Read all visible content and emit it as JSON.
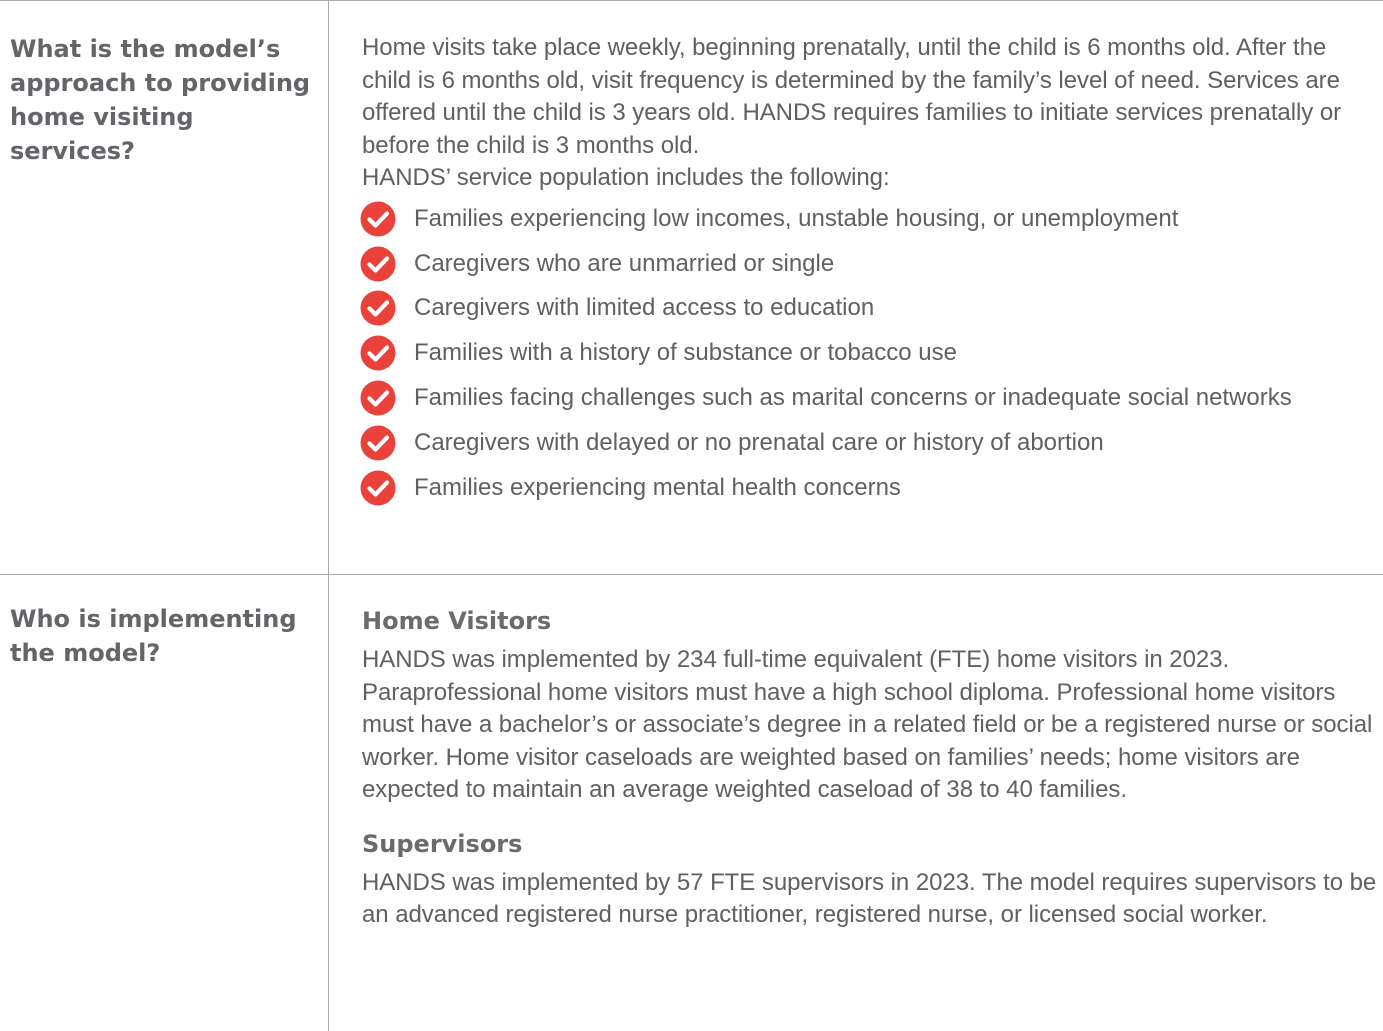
{
  "rows": [
    {
      "question": "What is the model’s approach to providing home visiting services?",
      "paragraph": "Home visits take place weekly, beginning prenatally, until the child is 6 months old. After the child is 6 months old, visit frequency is determined by the family’s level of need. Services are offered until the child is 3 years old. HANDS requires families to initiate services prenatally or before the child is 3 months old.",
      "list_intro": "HANDS’ service population includes the following:",
      "list": [
        "Families experiencing low incomes, unstable housing, or unemployment",
        "Caregivers who are unmarried or single",
        "Caregivers with limited access to education",
        "Families with a history of substance or tobacco use",
        "Families facing challenges such as marital concerns or inadequate social networks",
        "Caregivers with delayed or no prenatal care or history of abortion",
        "Families experiencing mental health concerns"
      ],
      "check_icon": "check-circle-icon",
      "check_color": "#e8423b"
    },
    {
      "question": "Who is implementing the model?",
      "sections": [
        {
          "heading": "Home Visitors",
          "body": "HANDS was implemented by 234 full-time equivalent (FTE) home visitors in 2023. Paraprofessional home visitors must have a high school diploma. Professional home visitors must have a bachelor’s or associate’s degree in a related field or be a registered nurse or social worker. Home visitor caseloads are weighted based on families’ needs; home visitors are expected to maintain an average weighted caseload of 38 to 40 families."
        },
        {
          "heading": "Supervisors",
          "body": "HANDS was implemented by 57 FTE supervisors in 2023. The model requires supervisors to be an advanced registered nurse practitioner, registered nurse, or licensed social worker."
        }
      ]
    }
  ]
}
